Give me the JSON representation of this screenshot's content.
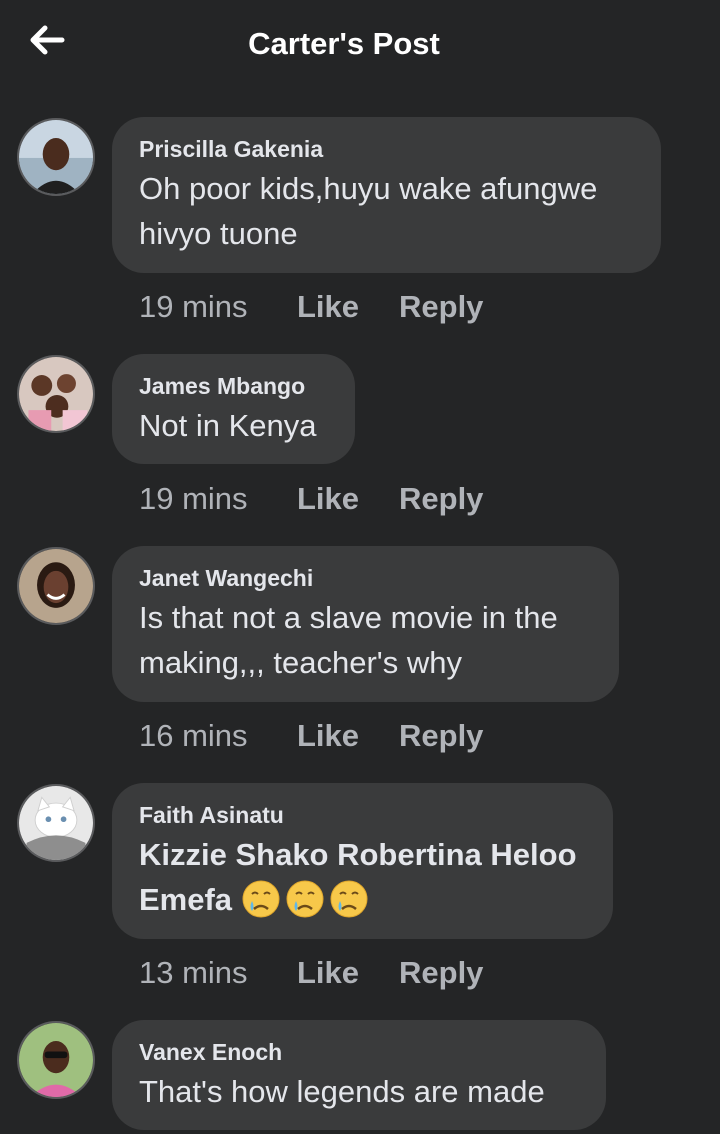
{
  "header": {
    "title": "Carter's Post",
    "back_icon": "arrow-left-icon"
  },
  "colors": {
    "background": "#242526",
    "bubble": "#3a3b3c",
    "text": "#e4e6eb",
    "meta": "#b0b3b8"
  },
  "comments": [
    {
      "author": "Priscilla Gakenia",
      "text": "Oh poor kids,huyu wake afungwe hivyo tuone",
      "time": "19 mins",
      "like": "Like",
      "reply": "Reply"
    },
    {
      "author": "James Mbango",
      "text": "Not in Kenya",
      "time": "19 mins",
      "like": "Like",
      "reply": "Reply"
    },
    {
      "author": "Janet Wangechi",
      "text": "Is that not a slave movie in the making,,, teacher's why",
      "time": "16 mins",
      "like": "Like",
      "reply": "Reply"
    },
    {
      "author": "Faith Asinatu",
      "text": "Kizzie Shako Robertina Heloo Emefa",
      "emoji": "sad-but-relieved-face-icon",
      "time": "13 mins",
      "like": "Like",
      "reply": "Reply"
    },
    {
      "author": "Vanex Enoch",
      "text": "That's how legends are made"
    }
  ]
}
